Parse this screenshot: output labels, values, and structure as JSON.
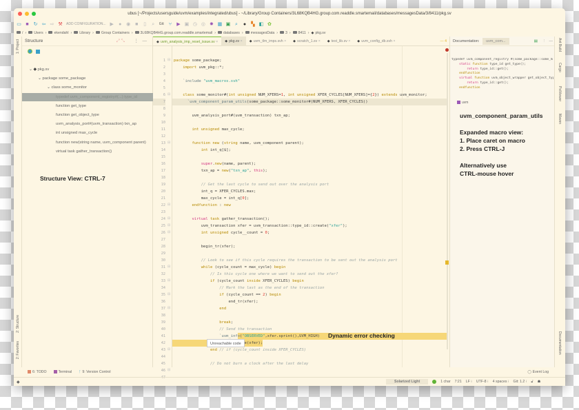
{
  "window": {
    "title": "ubus [~/Projects/usersguide/uvm/examples/integrated/ubus] - ~/Library/Group Containers/3L68KQB4HG.group.com.readdle.smartemail/databases/messagesData/3/8411/pkg.sv"
  },
  "toolbar": {
    "add_configuration": "ADD CONFIGURATION...",
    "git_label": "Git:"
  },
  "breadcrumb": [
    "/",
    "Users",
    "ekendahl",
    "Library",
    "Group Containers",
    "3L68KQB4HG.group.com.readdle.smartemail",
    "databases",
    "messagesData",
    "3",
    "8411",
    "pkg.sv"
  ],
  "left_strip": {
    "project": "1: Project",
    "structure": "2: Structure",
    "favorites": "2: Favorites"
  },
  "right_strip": {
    "ant": "Ant Build",
    "cargo": "Cargo",
    "psi": "PsiViewer",
    "maven": "Maven",
    "documentation": "Documentation"
  },
  "structure": {
    "title": "Structure",
    "items": [
      {
        "label": "pkg.sv",
        "depth": 0
      },
      {
        "label": "package some_package",
        "depth": 1
      },
      {
        "label": "class some_monitor",
        "depth": 2
      },
      {
        "label": "typedef uvm_component_registry#(...) type_id",
        "depth": 3,
        "selected": true
      },
      {
        "label": "function get_type",
        "depth": 3
      },
      {
        "label": "function get_object_type",
        "depth": 3
      },
      {
        "label": "uvm_analysis_port#(uvm_transaction) txn_ap",
        "depth": 3
      },
      {
        "label": "int unsigned max_cycle",
        "depth": 3
      },
      {
        "label": "function new(string name, uvm_component parent)",
        "depth": 3
      },
      {
        "label": "virtual task gather_transaction()",
        "depth": 3
      }
    ]
  },
  "tabs": [
    {
      "label": "uvm_analysis_imp_reset_issue.sv",
      "state": "modified"
    },
    {
      "label": "pkg.sv",
      "state": "active"
    },
    {
      "label": "uvm_tlm_imps.svh"
    },
    {
      "label": "scratch_1.sv"
    },
    {
      "label": "test_lib.sv"
    },
    {
      "label": "uvm_config_db.svh"
    }
  ],
  "editor": {
    "caret_line": 7,
    "highlight_lines": [
      41,
      42
    ],
    "lines": [
      "package some_package;",
      "    import uvm_pkg::*;",
      "",
      "    `include \"uvm_macros.svh\"",
      "",
      "    class some_monitor#(int unsigned NUM_XFERS=1, int unsigned XFER_CYCLES[NUM_XFERS]={2}) extends uvm_monitor;",
      "      `uvm_component_param_utils(some_package::some_monitor#(NUM_XFERS, XFER_CYCLES))",
      "",
      "        uvm_analysis_port#(uvm_transaction) txn_ap;",
      "",
      "        int unsigned max_cycle;",
      "",
      "        function new (string name, uvm_component parent);",
      "            int int_q[$];",
      "",
      "            super.new(name, parent);",
      "            txn_ap = new(\"txn_ap\", this);",
      "",
      "            // Get the last cycle to send out over the analysis port",
      "            int_q = XFER_CYCLES.max;",
      "            max_cycle = int_q[0];",
      "        endfunction : new",
      "",
      "        virtual task gather_transaction();",
      "            uvm_transaction xfer = uvm_transaction::type_id::create(\"xfer\");",
      "            int unsigned cycle__count = 0;",
      "",
      "            begin_tr(xfer);",
      "",
      "            // Look to see if this cycle requires the transaction to be sent out the analysis port",
      "            while (cycle_count = max_cycle) begin",
      "                // Is this cycle one where we want to send out the xfer?",
      "                if (cycle_count inside XFER_CYCLES) begin",
      "                    // Mark the last as the end of the transaction",
      "                    if (cycle_count == 2) begin",
      "                        end_tr(xfer);",
      "                    end",
      "",
      "                    break;",
      "                    // Send the transaction",
      "                    `uvm_info(\"OBSERVED\",xfer.sprint(),UVM_HIGH)",
      "                    txn_ap.write(xfer);",
      "                end // if (cycle_count inside XFER_CYCLES)",
      "",
      "                // Do not burn a clock after the last delay",
      "                if (cycle_count ≠ max_cycle) begin",
      "                    // wait a clock"
    ]
  },
  "tooltip": "Unreachable code",
  "documentation": {
    "title": "Documentation:",
    "tab": "uvm_com...",
    "code": [
      "typedef uvm_component_registry #(some_package::some_m",
      "    static function type_id get_type();",
      "        return type_id::get();",
      "    endfunction",
      "    virtual function uvm_object_wrapper get_object_type",
      "        return type_id::get();",
      "    endfunction"
    ],
    "package": "uvm"
  },
  "annotations": {
    "structure_view": "Structure View: CTRL-7",
    "dynamic": "Dynamic error checking",
    "macro_name": "uvm_component_param_utils",
    "expanded": "Expanded macro view:",
    "step1": "1. Place caret on macro",
    "step2": "2. Press CTRL-J",
    "alt1": "Alternatively use",
    "alt2": "CTRL-mouse hover"
  },
  "bottom_tools": {
    "todo": "6: TODO",
    "terminal": "Terminal",
    "vcs": "9: Version Control",
    "event_log": "Event Log"
  },
  "status": {
    "theme": "Solarized Light",
    "chars": "1 char",
    "position": "7:21",
    "line_sep": "LF ⁝",
    "encoding": "UTF-8 ⁝",
    "indent": "4 spaces ⁝",
    "git": "Git: 1.2 ⁝"
  },
  "colors": {
    "editor_bg": "#fdf6e3",
    "keyword": "#b58900",
    "string": "#2aa198",
    "number": "#dc322f",
    "special": "#d33682",
    "highlight": "#f6d778",
    "selection": "#a7aca6"
  }
}
